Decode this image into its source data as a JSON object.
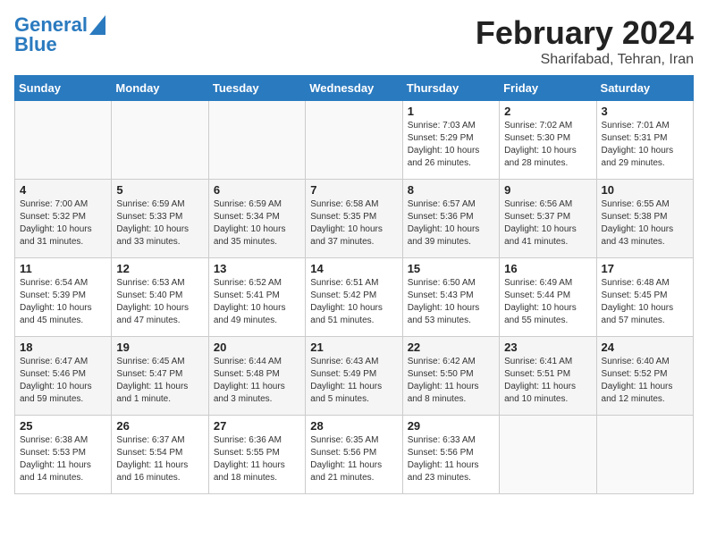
{
  "header": {
    "logo_line1": "General",
    "logo_line2": "Blue",
    "month_title": "February 2024",
    "subtitle": "Sharifabad, Tehran, Iran"
  },
  "weekdays": [
    "Sunday",
    "Monday",
    "Tuesday",
    "Wednesday",
    "Thursday",
    "Friday",
    "Saturday"
  ],
  "weeks": [
    [
      {
        "day": "",
        "sunrise": "",
        "sunset": "",
        "daylight": ""
      },
      {
        "day": "",
        "sunrise": "",
        "sunset": "",
        "daylight": ""
      },
      {
        "day": "",
        "sunrise": "",
        "sunset": "",
        "daylight": ""
      },
      {
        "day": "",
        "sunrise": "",
        "sunset": "",
        "daylight": ""
      },
      {
        "day": "1",
        "sunrise": "Sunrise: 7:03 AM",
        "sunset": "Sunset: 5:29 PM",
        "daylight": "Daylight: 10 hours and 26 minutes."
      },
      {
        "day": "2",
        "sunrise": "Sunrise: 7:02 AM",
        "sunset": "Sunset: 5:30 PM",
        "daylight": "Daylight: 10 hours and 28 minutes."
      },
      {
        "day": "3",
        "sunrise": "Sunrise: 7:01 AM",
        "sunset": "Sunset: 5:31 PM",
        "daylight": "Daylight: 10 hours and 29 minutes."
      }
    ],
    [
      {
        "day": "4",
        "sunrise": "Sunrise: 7:00 AM",
        "sunset": "Sunset: 5:32 PM",
        "daylight": "Daylight: 10 hours and 31 minutes."
      },
      {
        "day": "5",
        "sunrise": "Sunrise: 6:59 AM",
        "sunset": "Sunset: 5:33 PM",
        "daylight": "Daylight: 10 hours and 33 minutes."
      },
      {
        "day": "6",
        "sunrise": "Sunrise: 6:59 AM",
        "sunset": "Sunset: 5:34 PM",
        "daylight": "Daylight: 10 hours and 35 minutes."
      },
      {
        "day": "7",
        "sunrise": "Sunrise: 6:58 AM",
        "sunset": "Sunset: 5:35 PM",
        "daylight": "Daylight: 10 hours and 37 minutes."
      },
      {
        "day": "8",
        "sunrise": "Sunrise: 6:57 AM",
        "sunset": "Sunset: 5:36 PM",
        "daylight": "Daylight: 10 hours and 39 minutes."
      },
      {
        "day": "9",
        "sunrise": "Sunrise: 6:56 AM",
        "sunset": "Sunset: 5:37 PM",
        "daylight": "Daylight: 10 hours and 41 minutes."
      },
      {
        "day": "10",
        "sunrise": "Sunrise: 6:55 AM",
        "sunset": "Sunset: 5:38 PM",
        "daylight": "Daylight: 10 hours and 43 minutes."
      }
    ],
    [
      {
        "day": "11",
        "sunrise": "Sunrise: 6:54 AM",
        "sunset": "Sunset: 5:39 PM",
        "daylight": "Daylight: 10 hours and 45 minutes."
      },
      {
        "day": "12",
        "sunrise": "Sunrise: 6:53 AM",
        "sunset": "Sunset: 5:40 PM",
        "daylight": "Daylight: 10 hours and 47 minutes."
      },
      {
        "day": "13",
        "sunrise": "Sunrise: 6:52 AM",
        "sunset": "Sunset: 5:41 PM",
        "daylight": "Daylight: 10 hours and 49 minutes."
      },
      {
        "day": "14",
        "sunrise": "Sunrise: 6:51 AM",
        "sunset": "Sunset: 5:42 PM",
        "daylight": "Daylight: 10 hours and 51 minutes."
      },
      {
        "day": "15",
        "sunrise": "Sunrise: 6:50 AM",
        "sunset": "Sunset: 5:43 PM",
        "daylight": "Daylight: 10 hours and 53 minutes."
      },
      {
        "day": "16",
        "sunrise": "Sunrise: 6:49 AM",
        "sunset": "Sunset: 5:44 PM",
        "daylight": "Daylight: 10 hours and 55 minutes."
      },
      {
        "day": "17",
        "sunrise": "Sunrise: 6:48 AM",
        "sunset": "Sunset: 5:45 PM",
        "daylight": "Daylight: 10 hours and 57 minutes."
      }
    ],
    [
      {
        "day": "18",
        "sunrise": "Sunrise: 6:47 AM",
        "sunset": "Sunset: 5:46 PM",
        "daylight": "Daylight: 10 hours and 59 minutes."
      },
      {
        "day": "19",
        "sunrise": "Sunrise: 6:45 AM",
        "sunset": "Sunset: 5:47 PM",
        "daylight": "Daylight: 11 hours and 1 minute."
      },
      {
        "day": "20",
        "sunrise": "Sunrise: 6:44 AM",
        "sunset": "Sunset: 5:48 PM",
        "daylight": "Daylight: 11 hours and 3 minutes."
      },
      {
        "day": "21",
        "sunrise": "Sunrise: 6:43 AM",
        "sunset": "Sunset: 5:49 PM",
        "daylight": "Daylight: 11 hours and 5 minutes."
      },
      {
        "day": "22",
        "sunrise": "Sunrise: 6:42 AM",
        "sunset": "Sunset: 5:50 PM",
        "daylight": "Daylight: 11 hours and 8 minutes."
      },
      {
        "day": "23",
        "sunrise": "Sunrise: 6:41 AM",
        "sunset": "Sunset: 5:51 PM",
        "daylight": "Daylight: 11 hours and 10 minutes."
      },
      {
        "day": "24",
        "sunrise": "Sunrise: 6:40 AM",
        "sunset": "Sunset: 5:52 PM",
        "daylight": "Daylight: 11 hours and 12 minutes."
      }
    ],
    [
      {
        "day": "25",
        "sunrise": "Sunrise: 6:38 AM",
        "sunset": "Sunset: 5:53 PM",
        "daylight": "Daylight: 11 hours and 14 minutes."
      },
      {
        "day": "26",
        "sunrise": "Sunrise: 6:37 AM",
        "sunset": "Sunset: 5:54 PM",
        "daylight": "Daylight: 11 hours and 16 minutes."
      },
      {
        "day": "27",
        "sunrise": "Sunrise: 6:36 AM",
        "sunset": "Sunset: 5:55 PM",
        "daylight": "Daylight: 11 hours and 18 minutes."
      },
      {
        "day": "28",
        "sunrise": "Sunrise: 6:35 AM",
        "sunset": "Sunset: 5:56 PM",
        "daylight": "Daylight: 11 hours and 21 minutes."
      },
      {
        "day": "29",
        "sunrise": "Sunrise: 6:33 AM",
        "sunset": "Sunset: 5:56 PM",
        "daylight": "Daylight: 11 hours and 23 minutes."
      },
      {
        "day": "",
        "sunrise": "",
        "sunset": "",
        "daylight": ""
      },
      {
        "day": "",
        "sunrise": "",
        "sunset": "",
        "daylight": ""
      }
    ]
  ]
}
